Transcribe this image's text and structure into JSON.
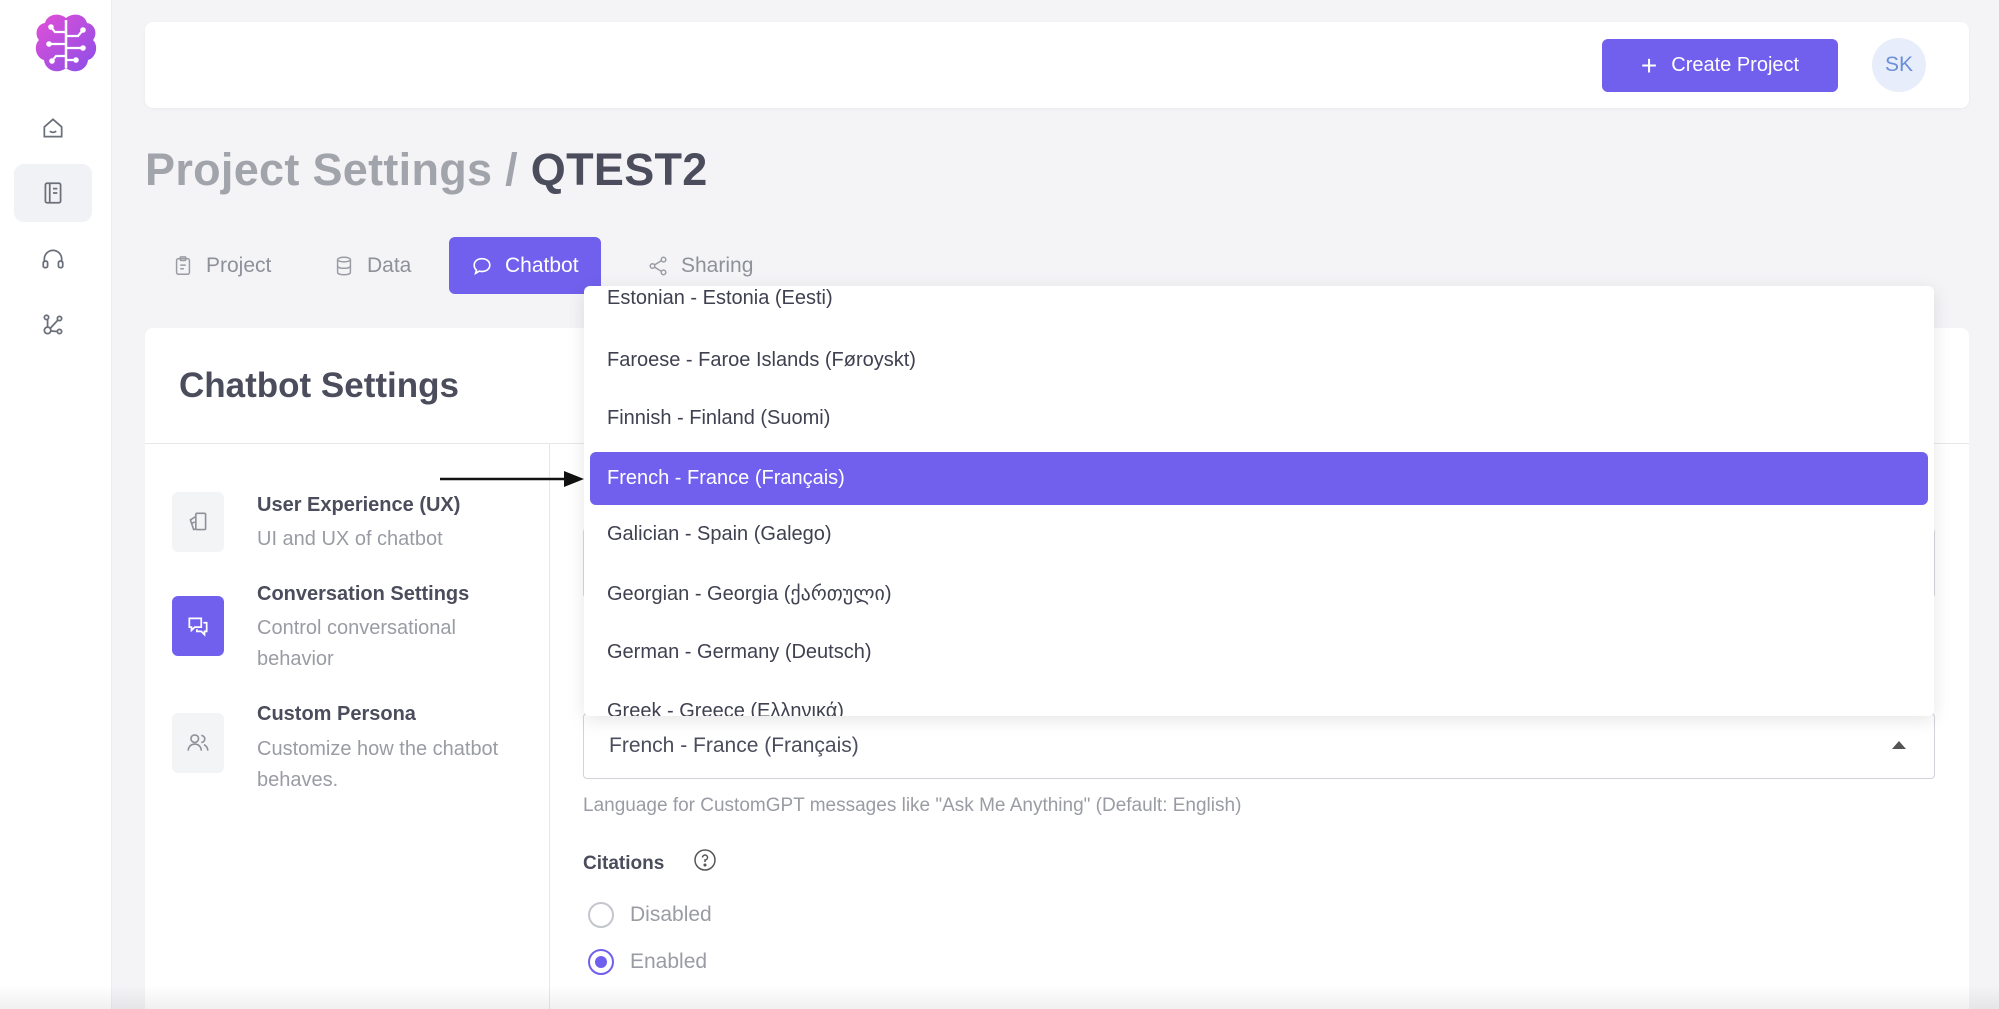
{
  "header": {
    "create_project_label": "Create Project",
    "avatar_initials": "SK"
  },
  "page": {
    "title_prefix": "Project Settings /",
    "project_name": "QTEST2"
  },
  "tabs": [
    {
      "label": "Project",
      "icon": "clipboard-icon",
      "active": false
    },
    {
      "label": "Data",
      "icon": "database-icon",
      "active": false
    },
    {
      "label": "Chatbot",
      "icon": "chat-bubble-icon",
      "active": true
    },
    {
      "label": "Sharing",
      "icon": "share-icon",
      "active": false
    }
  ],
  "settings": {
    "title": "Chatbot Settings",
    "sections": [
      {
        "title": "User Experience (UX)",
        "desc": "UI and UX of chatbot",
        "icon": "layers-icon",
        "active": false
      },
      {
        "title": "Conversation Settings",
        "desc": "Control conversational behavior",
        "icon": "conversation-icon",
        "active": true
      },
      {
        "title": "Custom Persona",
        "desc": "Customize how the chatbot behaves.",
        "icon": "users-icon",
        "active": false
      }
    ]
  },
  "language_select": {
    "value": "French - France (Français)",
    "help": "Language for CustomGPT messages like \"Ask Me Anything\" (Default: English)",
    "options": [
      "Estonian - Estonia (Eesti)",
      "Faroese - Faroe Islands (Føroyskt)",
      "Finnish - Finland (Suomi)",
      "French - France (Français)",
      "Galician - Spain (Galego)",
      "Georgian - Georgia (ქართული)",
      "German - Germany (Deutsch)",
      "Greek - Greece (Ελληνικά)"
    ],
    "selected_index": 3
  },
  "citations": {
    "label": "Citations",
    "options": [
      "Disabled",
      "Enabled"
    ],
    "selected": "Enabled"
  },
  "colors": {
    "accent": "#7060ed",
    "muted_text": "#9a9ca4",
    "heading_text": "#4b4d5c"
  }
}
